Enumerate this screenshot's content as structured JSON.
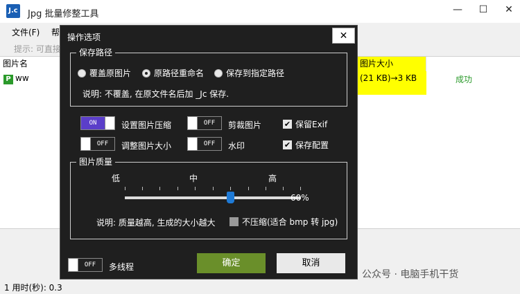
{
  "window": {
    "app_icon_text": "J.c",
    "title": "Jpg 批量修整工具",
    "minimize": "—",
    "maximize": "☐",
    "close": "✕"
  },
  "menu": {
    "items": [
      "文件(F)",
      "帮"
    ]
  },
  "hint": "提示: 可直接",
  "table": {
    "headers": [
      "图片名",
      "图片大小"
    ],
    "row": {
      "icon_text": "P",
      "name": "ww",
      "size": "(21 KB)→3 KB",
      "status": "成功"
    }
  },
  "status": {
    "text": "1  用时(秒): 0.3"
  },
  "watermark": "公众号 · 电脑手机干货",
  "dialog": {
    "title": "操作选项",
    "close": "✕",
    "save_path": {
      "label": "保存路径",
      "options": [
        "覆盖原图片",
        "原路径重命名",
        "保存到指定路径"
      ],
      "selected_index": 1,
      "note": "说明: 不覆盖, 在原文件名后加 _Jc 保存."
    },
    "toggles": {
      "compress": {
        "state": "ON",
        "label": "设置图片压缩"
      },
      "crop": {
        "state": "OFF",
        "label": "剪裁图片"
      },
      "resize": {
        "state": "OFF",
        "label": "调整图片大小"
      },
      "watermark": {
        "state": "OFF",
        "label": "水印"
      },
      "multithread": {
        "state": "OFF",
        "label": "多线程"
      }
    },
    "checks": {
      "keep_exif": {
        "checked": true,
        "label": "保留Exif"
      },
      "save_config": {
        "checked": true,
        "label": "保存配置"
      },
      "no_compress": {
        "checked": false,
        "label": "不压缩(适合 bmp 转 jpg)"
      }
    },
    "quality": {
      "label": "图片质量",
      "low": "低",
      "mid": "中",
      "high": "高",
      "value_text": "60%",
      "value": 0.6,
      "note": "说明: 质量越高, 生成的大小越大"
    },
    "ok": "确定",
    "cancel": "取消"
  }
}
